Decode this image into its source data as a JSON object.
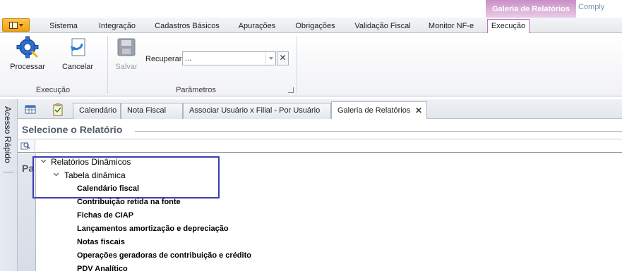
{
  "title_bar": {
    "context_group": "Galeria de Relatórios",
    "product": "Comply"
  },
  "ribbon_tabs": [
    "Sistema",
    "Integração",
    "Cadastros Básicos",
    "Apurações",
    "Obrigações",
    "Validação Fiscal",
    "Monitor NF-e",
    "Execução"
  ],
  "active_ribbon_tab": "Execução",
  "ribbon": {
    "execucao": {
      "label": "Execução",
      "processar": "Processar",
      "cancelar": "Cancelar"
    },
    "parametros": {
      "label": "Parâmetros",
      "salvar": "Salvar",
      "recuperar_label": "Recuperar",
      "recuperar_value": "..."
    }
  },
  "quick_access": "Acesso Rápido",
  "doc_tabs": [
    "Calendário",
    "Nota Fiscal",
    "Associar Usuário x Filial - Por Usuário",
    "Galeria de Relatórios"
  ],
  "active_doc_tab": "Galeria de Relatórios",
  "content": {
    "section_title": "Selecione o Relatório",
    "panel_label_partial": "Pa",
    "tree": {
      "root": "Relatórios Dinâmicos",
      "child": "Tabela dinâmica",
      "reports": [
        "Calendário fiscal",
        "Contribuição retida na fonte",
        "Fichas de CIAP",
        "Lançamentos amortização e depreciação",
        "Notas fiscais",
        "Operações geradoras de contribuição e crédito",
        "PDV Analítico"
      ]
    }
  },
  "colors": {
    "context_group": "#d9a7d6",
    "app_menu": "#f5a623",
    "highlight_box": "#3a3fb0"
  }
}
